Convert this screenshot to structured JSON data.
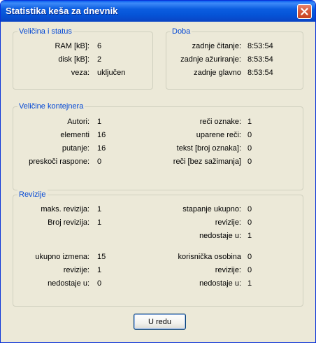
{
  "window": {
    "title": "Statistika keša za dnevnik",
    "ok_label": "U redu"
  },
  "size_status": {
    "legend": "Veličina i status",
    "rows": [
      {
        "label": "RAM [kB]:",
        "value": "6"
      },
      {
        "label": "disk [kB]:",
        "value": "2"
      },
      {
        "label": "veza:",
        "value": "uključen"
      }
    ]
  },
  "time": {
    "legend": "Doba",
    "rows": [
      {
        "label": "zadnje čitanje:",
        "value": "8:53:54"
      },
      {
        "label": "zadnje ažuriranje:",
        "value": "8:53:54"
      },
      {
        "label": "zadnje glavno",
        "value": "8:53:54"
      }
    ]
  },
  "container": {
    "legend": "Veličine kontejnera",
    "left": [
      {
        "label": "Autori:",
        "value": "1"
      },
      {
        "label": "elementi",
        "value": "16"
      },
      {
        "label": "putanje:",
        "value": "16"
      },
      {
        "label": "preskoči raspone:",
        "value": "0"
      }
    ],
    "right": [
      {
        "label": "reči oznake:",
        "value": "1"
      },
      {
        "label": "uparene reči:",
        "value": "0"
      },
      {
        "label": "tekst [broj oznaka]:",
        "value": "0"
      },
      {
        "label": "reči [bez sažimanja]",
        "value": "0"
      }
    ]
  },
  "revisions": {
    "legend": "Revizije",
    "left": [
      {
        "label": "maks. revizija:",
        "value": "1"
      },
      {
        "label": "Broj revizija:",
        "value": "1"
      },
      {
        "label": "ukupno izmena:",
        "value": "15"
      },
      {
        "label": "revizije:",
        "value": "1"
      },
      {
        "label": "nedostaje u:",
        "value": "0"
      }
    ],
    "right": [
      {
        "label": "stapanje ukupno:",
        "value": "0"
      },
      {
        "label": "revizije:",
        "value": "0"
      },
      {
        "label": "nedostaje u:",
        "value": "1"
      },
      {
        "label": "korisnička osobina",
        "value": "0"
      },
      {
        "label": "revizije:",
        "value": "0"
      },
      {
        "label": "nedostaje u:",
        "value": "1"
      }
    ]
  }
}
